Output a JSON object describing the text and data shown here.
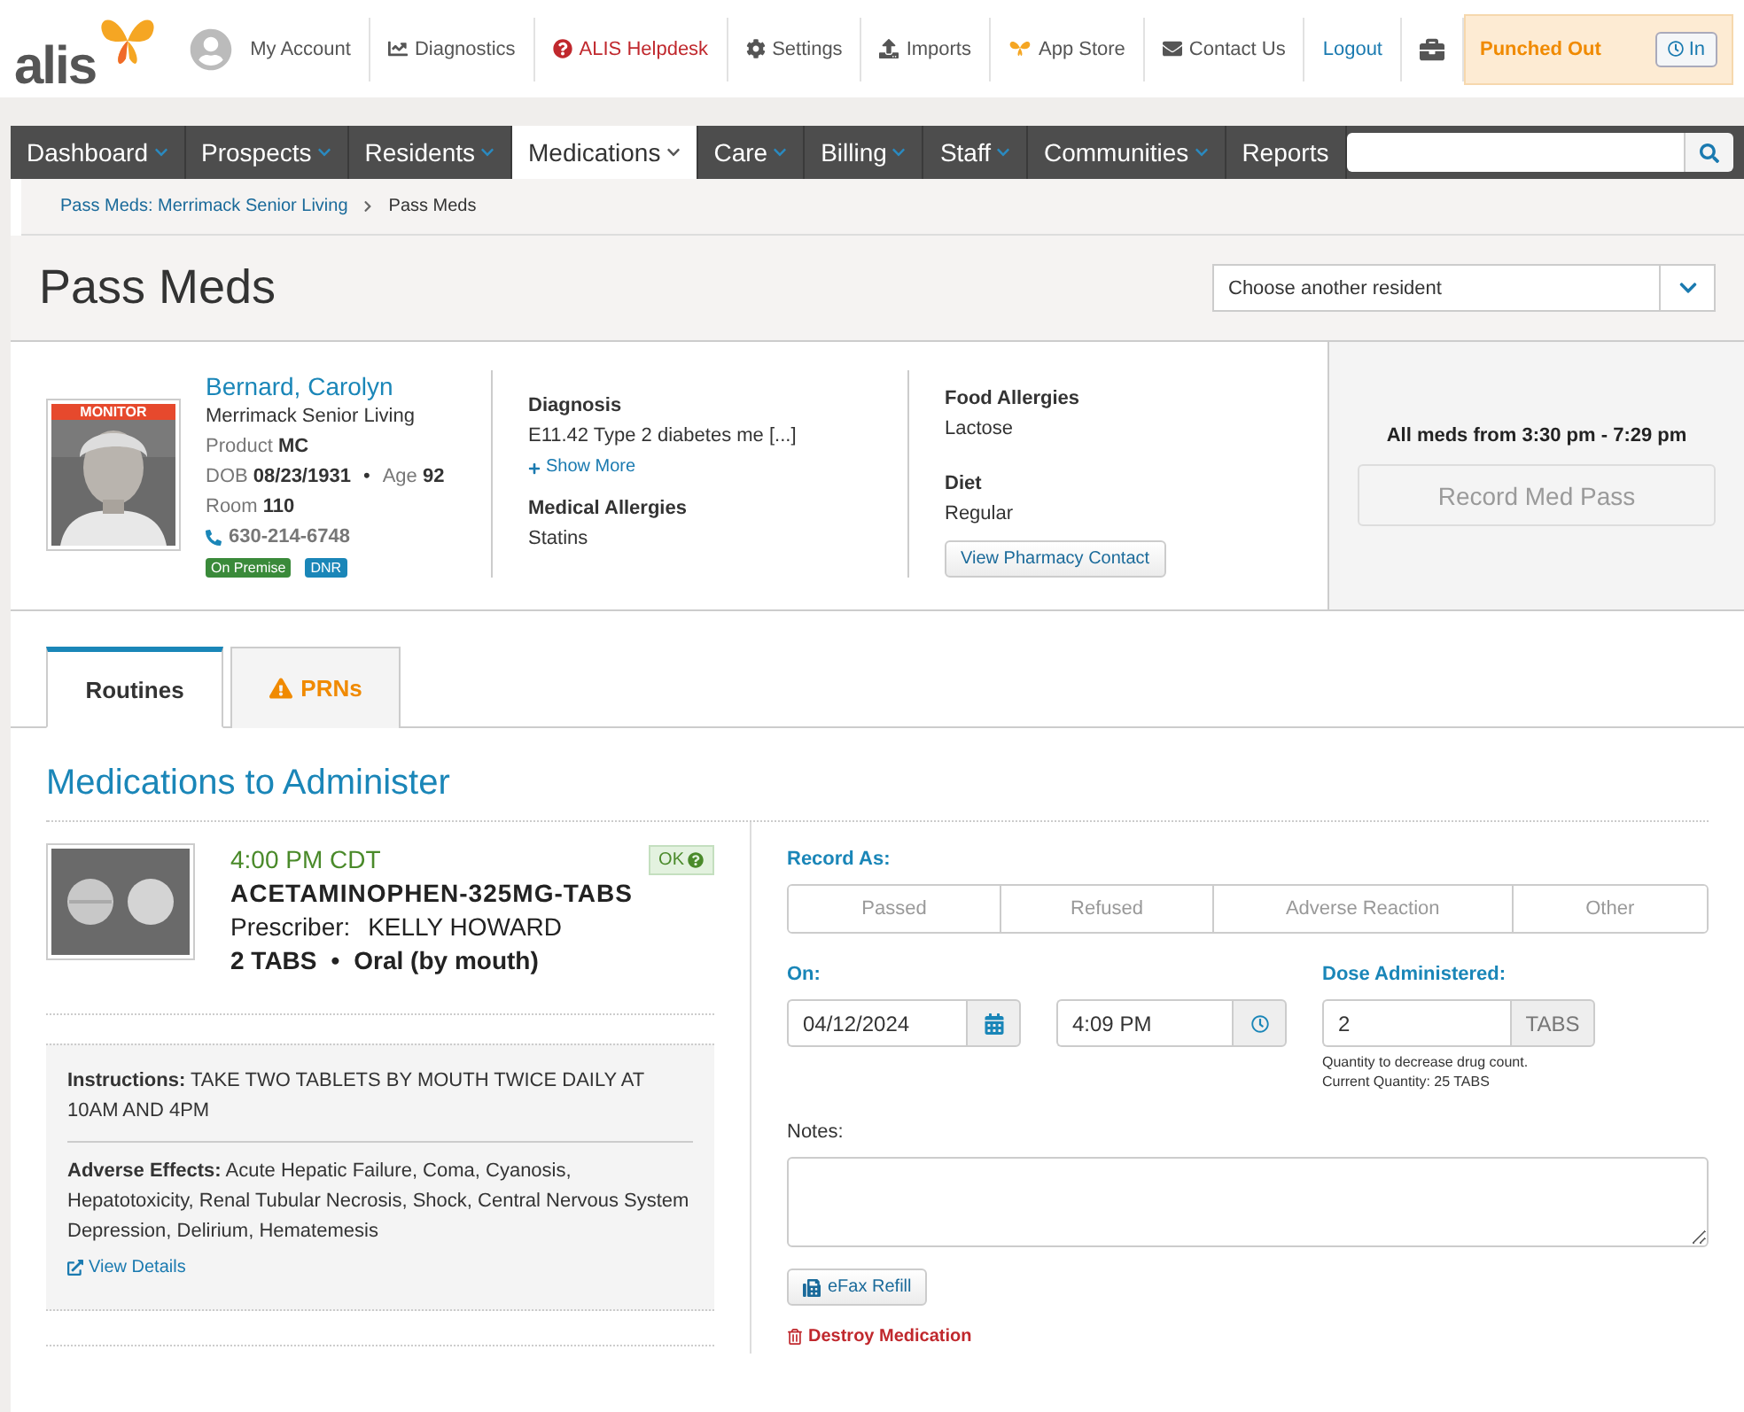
{
  "header": {
    "logo": "alis",
    "links": [
      {
        "kind": "avatar",
        "label": "My Account",
        "alert": false,
        "link": false
      },
      {
        "kind": "chart",
        "label": "Diagnostics",
        "alert": false,
        "link": false
      },
      {
        "kind": "help",
        "label": "ALIS Helpdesk",
        "alert": true,
        "link": false
      },
      {
        "kind": "gear",
        "label": "Settings",
        "alert": false,
        "link": false
      },
      {
        "kind": "upload",
        "label": "Imports",
        "alert": false,
        "link": false
      },
      {
        "kind": "butterfly",
        "label": "App Store",
        "alert": false,
        "link": false
      },
      {
        "kind": "mail",
        "label": "Contact Us",
        "alert": false,
        "link": false
      },
      {
        "kind": "none",
        "label": "Logout",
        "alert": false,
        "link": true
      },
      {
        "kind": "briefcase",
        "alert": false,
        "link": false
      }
    ],
    "punch": {
      "status": "Punched Out",
      "button": "In"
    }
  },
  "nav": {
    "items": [
      {
        "label": "Dashboard",
        "selected": false,
        "dropdown": true
      },
      {
        "label": "Prospects",
        "selected": false,
        "dropdown": true
      },
      {
        "label": "Residents",
        "selected": false,
        "dropdown": true
      },
      {
        "label": "Medications",
        "selected": true,
        "dropdown": true
      },
      {
        "label": "Care",
        "selected": false,
        "dropdown": true
      },
      {
        "label": "Billing",
        "selected": false,
        "dropdown": true
      },
      {
        "label": "Staff",
        "selected": false,
        "dropdown": true
      },
      {
        "label": "Communities",
        "selected": false,
        "dropdown": true
      },
      {
        "label": "Reports",
        "selected": false,
        "dropdown": false
      }
    ]
  },
  "breadcrumb": [
    {
      "label": "Pass Meds: Merrimack Senior Living",
      "link": true
    },
    {
      "label": "Pass Meds",
      "link": false
    }
  ],
  "page_title": "Pass Meds",
  "resident_select": {
    "placeholder": "Choose another resident"
  },
  "resident": {
    "badge": "MONITOR",
    "name": "Bernard, Carolyn",
    "community": "Merrimack Senior Living",
    "facts": [
      {
        "label": "Product",
        "value": "MC"
      }
    ],
    "separator": "•",
    "dob_label": "DOB",
    "dob": "08/23/1931",
    "age_label": "Age",
    "age": "92",
    "room_label": "Room",
    "room": "110",
    "phone": "630-214-6748",
    "tags": [
      {
        "label": "On Premise",
        "color": "#3a8a3a"
      },
      {
        "label": "DNR",
        "color": "#1a86b8"
      }
    ]
  },
  "diagnosis": {
    "label": "Diagnosis",
    "value": "E11.42 Type 2 diabetes me [...]",
    "more": "Show More"
  },
  "medical_allergies": {
    "label": "Medical Allergies",
    "value": "Statins"
  },
  "food_allergies": {
    "label": "Food Allergies",
    "value": "Lactose"
  },
  "diet": {
    "label": "Diet",
    "value": "Regular"
  },
  "pharmacy_button": "View Pharmacy Contact",
  "med_pass": {
    "window": "All meds from 3:30 pm - 7:29 pm",
    "button": "Record Med Pass",
    "disabled": true
  },
  "tabs": [
    {
      "label": "Routines",
      "selected": true,
      "warning": false
    },
    {
      "label": "PRNs",
      "selected": false,
      "warning": true
    }
  ],
  "section_title": "Medications to Administer",
  "medication": {
    "time": "4:00 PM CDT",
    "status": "OK",
    "name": "ACETAMINOPHEN-325MG-TABS",
    "prescriber_label": "Prescriber:",
    "prescriber": "KELLY HOWARD",
    "dose": "2 TABS",
    "separator": "•",
    "route": "Oral (by mouth)",
    "instructions": "**Instructions:** TAKE TWO TABLETS BY MOUTH TWICE DAILY AT 10AM AND 4PM",
    "adverse": "**Adverse Effects:** Acute Hepatic Failure, Coma, Cyanosis, Hepatotoxicity, Renal Tubular Necrosis, Shock, Central Nervous System Depression, Delirium, Hematemesis",
    "details": "View Details"
  },
  "form": {
    "record_as": "Record As:",
    "options": [
      {
        "label": "Passed",
        "selected": false
      },
      {
        "label": "Refused",
        "selected": false
      },
      {
        "label": "Adverse Reaction",
        "selected": false
      },
      {
        "label": "Other",
        "selected": false
      }
    ],
    "on_label": "On:",
    "date": "04/12/2024",
    "time": "4:09 PM",
    "dose_label": "Dose Administered:",
    "dose": "2",
    "unit": "TABS",
    "hint": [
      "Quantity to decrease drug count.",
      "Current Quantity: 25 TABS"
    ],
    "notes_label": "Notes:",
    "efax": "eFax Refill",
    "destroy": "Destroy Medication"
  }
}
